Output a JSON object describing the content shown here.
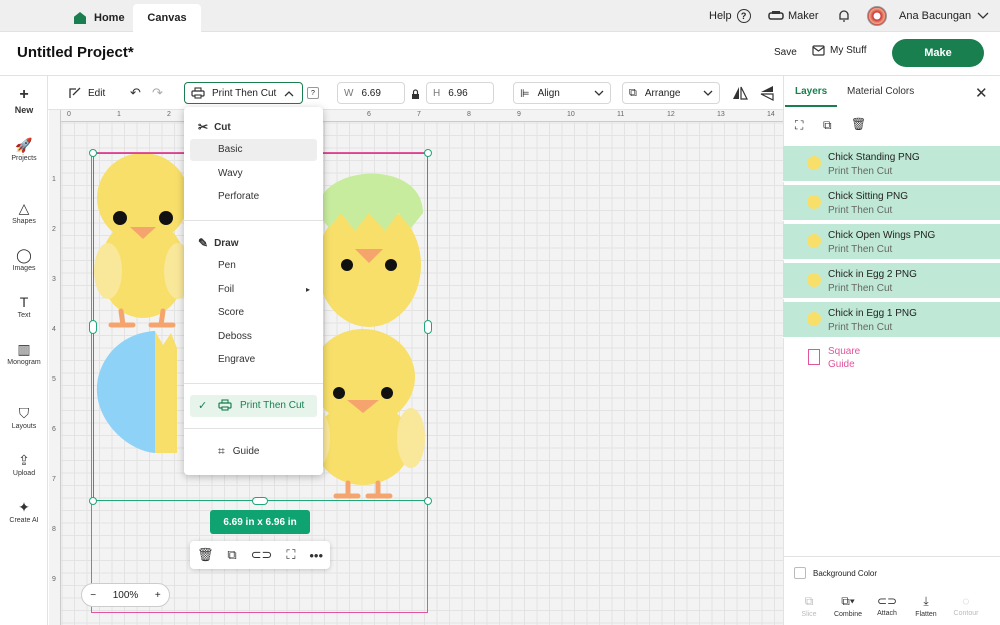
{
  "topbar": {
    "home": "Home",
    "canvas": "Canvas",
    "help": "Help",
    "maker": "Maker",
    "user": "Ana Bacungan"
  },
  "project": {
    "title": "Untitled Project*",
    "save": "Save",
    "mystuff": "My Stuff",
    "make": "Make"
  },
  "leftbar": {
    "items": [
      {
        "label": "New",
        "icon": "plus-icon"
      },
      {
        "label": "Projects",
        "icon": "rocket-icon"
      },
      {
        "label": "Shapes",
        "icon": "shapes-icon"
      },
      {
        "label": "Images",
        "icon": "bulb-icon"
      },
      {
        "label": "Text",
        "icon": "text-icon"
      },
      {
        "label": "Monogram",
        "icon": "monogram-icon"
      },
      {
        "label": "Layouts",
        "icon": "shirt-icon"
      },
      {
        "label": "Upload",
        "icon": "upload-icon"
      },
      {
        "label": "Create AI",
        "icon": "sparkle-icon"
      }
    ]
  },
  "toolbar": {
    "edit": "Edit",
    "operation": "Print Then Cut",
    "help_q": "?",
    "w_label": "W",
    "w_value": "6.69",
    "h_label": "H",
    "h_value": "6.96",
    "align": "Align",
    "arrange": "Arrange"
  },
  "ruler": {
    "top": [
      "0",
      "1",
      "2",
      "3",
      "4",
      "5",
      "6",
      "7",
      "8",
      "9",
      "10",
      "11",
      "12",
      "13",
      "14"
    ],
    "left": [
      "1",
      "2",
      "3",
      "4",
      "5",
      "6",
      "7",
      "8",
      "9"
    ]
  },
  "dropdown": {
    "cut_head": "Cut",
    "cut_items": [
      "Basic",
      "Wavy",
      "Perforate"
    ],
    "draw_head": "Draw",
    "draw_items": [
      "Pen",
      "Foil",
      "Score",
      "Deboss",
      "Engrave"
    ],
    "print_then_cut": "Print Then Cut",
    "guide": "Guide",
    "foil_arrow": "▸"
  },
  "selection": {
    "dimensions": "6.69  in x 6.96  in"
  },
  "zoom": {
    "minus": "−",
    "value": "100%",
    "plus": "+"
  },
  "rightpanel": {
    "tabs": [
      "Layers",
      "Material Colors"
    ],
    "layers": [
      {
        "name": "Chick Standing PNG",
        "sub": "Print Then Cut"
      },
      {
        "name": "Chick Sitting PNG",
        "sub": "Print Then Cut"
      },
      {
        "name": "Chick Open Wings PNG",
        "sub": "Print Then Cut"
      },
      {
        "name": "Chick in Egg 2 PNG",
        "sub": "Print Then Cut"
      },
      {
        "name": "Chick in Egg 1 PNG",
        "sub": "Print Then Cut"
      }
    ],
    "guide_layer": {
      "name": "Square",
      "sub": "Guide"
    },
    "background_color": "Background Color",
    "bottom": [
      "Slice",
      "Combine",
      "Attach",
      "Flatten",
      "Contour"
    ]
  },
  "colors": {
    "accent": "#1a7f4f",
    "layer_bg": "#bfe9d6",
    "guide": "#e0559b",
    "chick": "#f7df6a",
    "egg_blue": "#8fd2f7",
    "egg_green": "#c8ec9e"
  }
}
